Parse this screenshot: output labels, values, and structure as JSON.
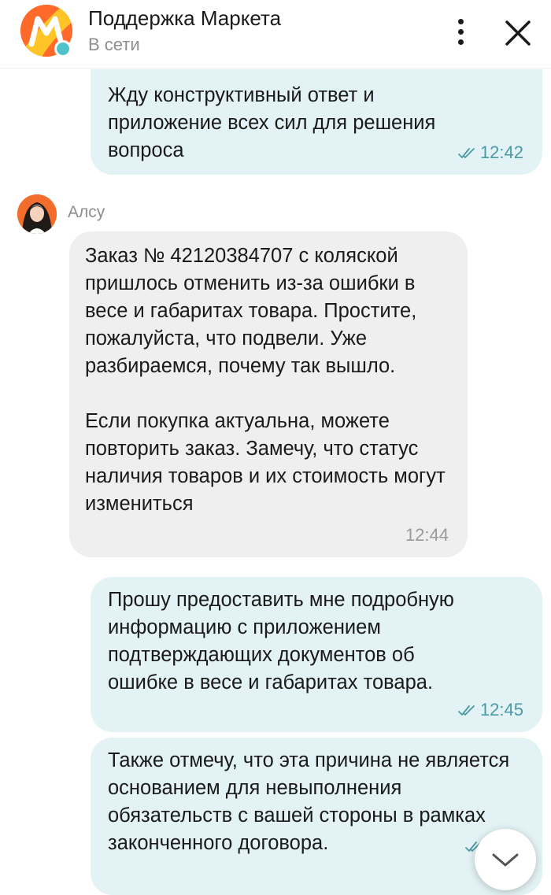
{
  "header": {
    "title": "Поддержка Маркета",
    "status": "В сети",
    "brand_color": "#ff6a2b",
    "online_color": "#4fc3c9",
    "icons": [
      "market-logo-icon",
      "more-vertical-icon",
      "close-icon"
    ]
  },
  "messages": [
    {
      "direction": "outgoing",
      "text": "Жду конструктивный ответ и приложение всех сил для решения вопроса",
      "time": "12:42",
      "read": true
    },
    {
      "direction": "incoming",
      "sender": "Алсу",
      "text": "Заказ № 42120384707 с коляской пришлось отменить из-за ошибки в весе и габаритах товара. Простите, пожалуйста, что подвели. Уже разбираемся, почему так вышло.\n\nЕсли покупка актуальна, можете повторить заказ. Замечу, что статус наличия товаров и их стоимость могут измениться",
      "time": "12:44"
    },
    {
      "direction": "outgoing",
      "text": "Прошу предоставить мне подробную информацию с приложением подтверждающих документов об ошибке в весе и габаритах товара.",
      "time": "12:45",
      "read": true
    },
    {
      "direction": "outgoing",
      "text": "Также отмечу, что эта причина не является основанием для невыполнения обязательств с вашей стороны в рамках законченного договора.",
      "time": "",
      "read": true
    }
  ],
  "colors": {
    "outgoing_bubble": "#e3f2f4",
    "incoming_bubble": "#efefef",
    "outgoing_meta": "#4a9aa6"
  }
}
